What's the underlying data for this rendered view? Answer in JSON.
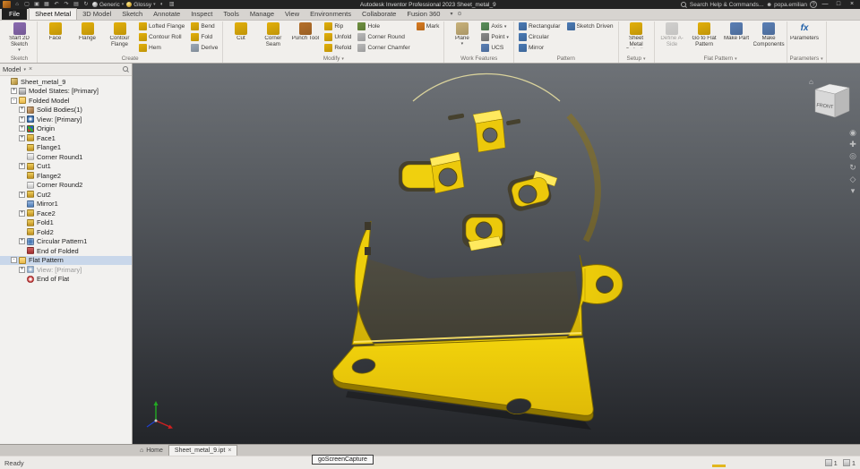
{
  "titlebar": {
    "qat_icons": [
      {
        "name": "home",
        "glyph": "⌂"
      },
      {
        "name": "new-file",
        "glyph": "▢"
      },
      {
        "name": "open-file",
        "glyph": "▣"
      },
      {
        "name": "save",
        "glyph": "▦"
      },
      {
        "name": "undo",
        "glyph": "↶"
      },
      {
        "name": "redo",
        "glyph": "↷"
      },
      {
        "name": "print",
        "glyph": "▤"
      },
      {
        "name": "update",
        "glyph": "↻"
      }
    ],
    "material_label": "Generic",
    "appearance_label": "Glossy",
    "post_icons": [
      {
        "name": "adjust-appearance",
        "glyph": "◐"
      },
      {
        "name": "measure",
        "glyph": "▥"
      }
    ],
    "app_title": "Autodesk Inventor Professional 2023  Sheet_metal_9",
    "search_label": "Search Help & Commands...",
    "user_name": "popa.emilian",
    "help_glyph": "?",
    "window": {
      "minimize": "—",
      "maximize": "□",
      "close": "×"
    }
  },
  "ribbon": {
    "arrow_glyph": "▾",
    "tabs": [
      "File",
      "Sheet Metal",
      "3D Model",
      "Sketch",
      "Annotate",
      "Inspect",
      "Tools",
      "Manage",
      "View",
      "Environments",
      "Collaborate",
      "Fusion 360"
    ],
    "active_tab": "Sheet Metal",
    "extras": [
      {
        "name": "ribbon-collapse-arrow-icon",
        "glyph": "▾"
      },
      {
        "name": "ribbon-display-toggle-icon",
        "glyph": "⊙"
      }
    ],
    "groups": [
      {
        "label": "Sketch",
        "arrow": false,
        "big": [
          {
            "label": "Start 2D Sketch",
            "icon": "start-2d-sketch",
            "arrow": true
          }
        ],
        "cols": []
      },
      {
        "label": "Create",
        "arrow": false,
        "big": [
          {
            "label": "Face",
            "icon": "face"
          },
          {
            "label": "Flange",
            "icon": "flange"
          },
          {
            "label": "Contour Flange",
            "icon": "contour-flange"
          }
        ],
        "cols": [
          [
            {
              "label": "Lofted Flange",
              "icon": "lofted-flange"
            },
            {
              "label": "Contour Roll",
              "icon": "contour-roll"
            },
            {
              "label": "Hem",
              "icon": "hem"
            }
          ],
          [
            {
              "label": "Bend",
              "icon": "bend"
            },
            {
              "label": "Fold",
              "icon": "fold"
            },
            {
              "label": "Derive",
              "icon": "derive"
            }
          ]
        ]
      },
      {
        "label": "Modify",
        "arrow": true,
        "big": [
          {
            "label": "Cut",
            "icon": "cut"
          },
          {
            "label": "Corner Seam",
            "icon": "corner-seam"
          },
          {
            "label": "Punch Tool",
            "icon": "punch-tool"
          }
        ],
        "cols": [
          [
            {
              "label": "Rip",
              "icon": "rip"
            },
            {
              "label": "Unfold",
              "icon": "unfold"
            },
            {
              "label": "Refold",
              "icon": "refold"
            }
          ],
          [
            {
              "label": "Hole",
              "icon": "hole"
            },
            {
              "label": "Corner Round",
              "icon": "corner-round"
            },
            {
              "label": "Corner Chamfer",
              "icon": "corner-chamfer"
            }
          ],
          [
            {
              "label": "Mark",
              "icon": "mark"
            }
          ]
        ]
      },
      {
        "label": "Work Features",
        "arrow": false,
        "big": [
          {
            "label": "Plane",
            "icon": "plane",
            "arrow": true
          }
        ],
        "cols": [
          [
            {
              "label": "Axis",
              "icon": "axis",
              "arrow": true
            },
            {
              "label": "Point",
              "icon": "point",
              "arrow": true
            },
            {
              "label": "UCS",
              "icon": "ucs"
            }
          ]
        ]
      },
      {
        "label": "Pattern",
        "arrow": false,
        "big": [],
        "cols": [
          [
            {
              "label": "Rectangular",
              "icon": "rectangular"
            },
            {
              "label": "Circular",
              "icon": "circular"
            },
            {
              "label": "Mirror",
              "icon": "mirror"
            }
          ],
          [
            {
              "label": "Sketch Driven",
              "icon": "sketch-driven"
            }
          ]
        ]
      },
      {
        "label": "Setup",
        "arrow": true,
        "big": [
          {
            "label": "Sheet Metal Defaults",
            "icon": "sheet-metal-defaults"
          }
        ],
        "cols": []
      },
      {
        "label": "Flat Pattern",
        "arrow": true,
        "big": [
          {
            "label": "Define A-Side",
            "icon": "define-a-side",
            "disabled": true
          },
          {
            "label": "Go to Flat Pattern",
            "icon": "go-to-flat-pattern"
          },
          {
            "label": "Make Part",
            "icon": "make-part"
          },
          {
            "label": "Make Components",
            "icon": "make-components"
          }
        ],
        "cols": []
      },
      {
        "label": "Parameters",
        "arrow": true,
        "big": [
          {
            "label": "Parameters",
            "icon": "parameters"
          }
        ],
        "cols": []
      }
    ]
  },
  "browser": {
    "title": "Model",
    "menu_arrow": "▾",
    "close_glyph": "×",
    "tree": [
      {
        "label": "Sheet_metal_9",
        "depth": 0,
        "icon": "part",
        "exp": ""
      },
      {
        "label": "Model States: [Primary]",
        "depth": 1,
        "icon": "model-states",
        "exp": "+"
      },
      {
        "label": "Folded Model",
        "depth": 1,
        "icon": "folder",
        "exp": "-"
      },
      {
        "label": "Solid Bodies(1)",
        "depth": 2,
        "icon": "solid",
        "exp": "+"
      },
      {
        "label": "View: [Primary]",
        "depth": 2,
        "icon": "view",
        "exp": "+"
      },
      {
        "label": "Origin",
        "depth": 2,
        "icon": "origin",
        "exp": "+"
      },
      {
        "label": "Face1",
        "depth": 2,
        "icon": "face",
        "exp": "+"
      },
      {
        "label": "Flange1",
        "depth": 2,
        "icon": "flange",
        "exp": ""
      },
      {
        "label": "Corner Round1",
        "depth": 2,
        "icon": "corner",
        "exp": ""
      },
      {
        "label": "Cut1",
        "depth": 2,
        "icon": "cut",
        "exp": "+"
      },
      {
        "label": "Flange2",
        "depth": 2,
        "icon": "flange",
        "exp": ""
      },
      {
        "label": "Corner Round2",
        "depth": 2,
        "icon": "corner",
        "exp": ""
      },
      {
        "label": "Cut2",
        "depth": 2,
        "icon": "cut",
        "exp": "+"
      },
      {
        "label": "Mirror1",
        "depth": 2,
        "icon": "mirror",
        "exp": ""
      },
      {
        "label": "Face2",
        "depth": 2,
        "icon": "face",
        "exp": "+"
      },
      {
        "label": "Fold1",
        "depth": 2,
        "icon": "fold",
        "exp": ""
      },
      {
        "label": "Fold2",
        "depth": 2,
        "icon": "fold",
        "exp": ""
      },
      {
        "label": "Circular Pattern1",
        "depth": 2,
        "icon": "pattern",
        "exp": "+"
      },
      {
        "label": "End of Folded",
        "depth": 2,
        "icon": "end",
        "exp": ""
      },
      {
        "label": "Flat Pattern",
        "depth": 1,
        "icon": "flat",
        "exp": "-",
        "selected": true
      },
      {
        "label": "View: [Primary]",
        "depth": 2,
        "icon": "view",
        "exp": "+",
        "grayed": true
      },
      {
        "label": "End of Flat",
        "depth": 2,
        "icon": "end-flat",
        "exp": ""
      }
    ]
  },
  "viewport": {
    "viewcube": "FRONT",
    "nav_icons": [
      {
        "name": "navigation-wheel-icon",
        "glyph": "◉"
      },
      {
        "name": "pan-icon",
        "glyph": "✚"
      },
      {
        "name": "zoom-icon",
        "glyph": "◎"
      },
      {
        "name": "orbit-icon",
        "glyph": "↻"
      },
      {
        "name": "look-at-icon",
        "glyph": "◇"
      },
      {
        "name": "navbar-menu-icon",
        "glyph": "▾"
      }
    ]
  },
  "docbar": {
    "home_glyph": "⌂",
    "home": "Home",
    "doc": "Sheet_metal_9.ipt",
    "close_glyph": "×"
  },
  "statusbar": {
    "left": "Ready",
    "count_a": "1",
    "count_b": "1"
  },
  "overlay": {
    "tooltip": "goScreenCapture"
  }
}
